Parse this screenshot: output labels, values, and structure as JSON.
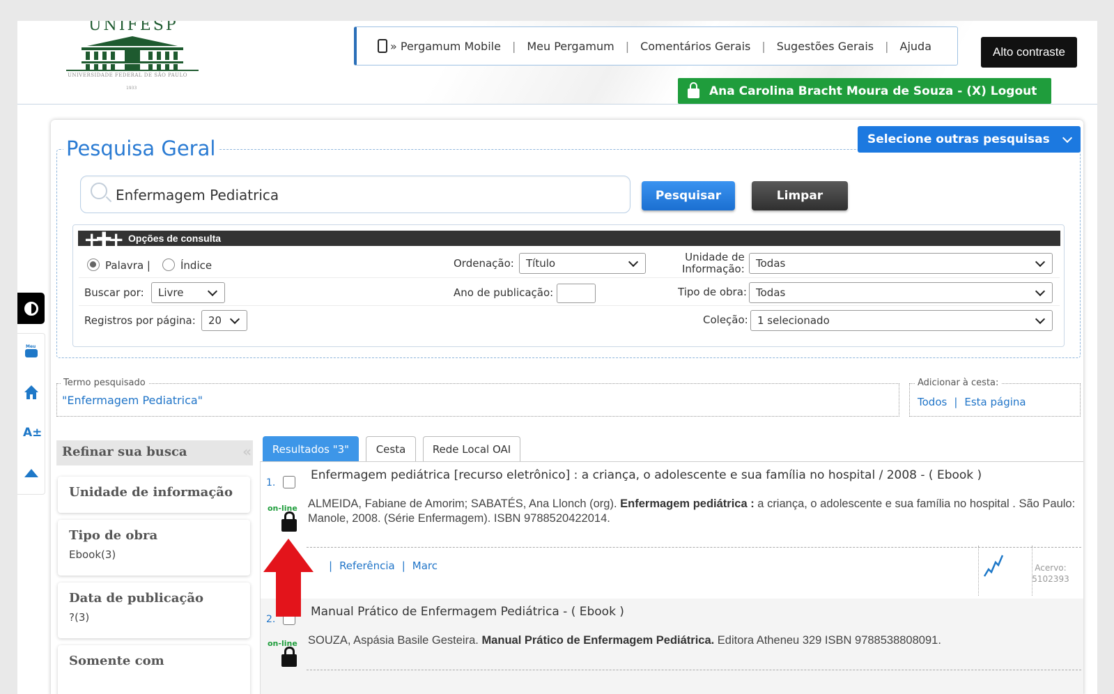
{
  "header": {
    "logo": {
      "name": "UNIFESP",
      "subtitle": "UNIVERSIDADE FEDERAL DE SÃO PAULO",
      "year": "1933"
    },
    "nav": [
      {
        "label": "» Pergamum Mobile",
        "icon": "mobile-icon"
      },
      {
        "label": "Meu Pergamum"
      },
      {
        "label": "Comentários Gerais"
      },
      {
        "label": "Sugestões Gerais"
      },
      {
        "label": "Ajuda"
      }
    ],
    "contrast_button": "Alto contraste",
    "user_bar": "Ana Carolina Bracht Moura de Souza - (X) Logout"
  },
  "accessibility_toolbar": {
    "icons": [
      "contrast-icon",
      "meu-pergamum-icon",
      "home-icon",
      "font-size-icon",
      "scroll-top-icon"
    ],
    "font_size_label": "A±"
  },
  "search_panel": {
    "title": "Pesquisa Geral",
    "other_searches": "Selecione outras pesquisas",
    "query": "Enfermagem Pediatrica",
    "search_button": "Pesquisar",
    "clear_button": "Limpar",
    "options": {
      "header": "Opções de consulta",
      "radio_palavra": "Palavra |",
      "radio_indice": "Índice",
      "radio_selected": "Palavra",
      "ordenacao_label": "Ordenação:",
      "ordenacao_value": "Título",
      "unidade_label_1": "Unidade de",
      "unidade_label_2": "Informação:",
      "unidade_value": "Todas",
      "buscar_label": "Buscar por:",
      "buscar_value": "Livre",
      "ano_label": "Ano de publicação:",
      "ano_value": "",
      "tipo_label": "Tipo de obra:",
      "tipo_value": "Todas",
      "registros_label": "Registros por página:",
      "registros_value": "20",
      "colecao_label": "Coleção:",
      "colecao_value": "1 selecionado"
    }
  },
  "termo": {
    "legend": "Termo pesquisado",
    "value": "\"Enfermagem Pediatrica\""
  },
  "cesta": {
    "legend": "Adicionar à cesta:",
    "todos": "Todos",
    "sep": "|",
    "esta_pagina": "Esta página"
  },
  "refine": {
    "title": "Refinar sua busca",
    "collapse_icon": "«",
    "groups": [
      {
        "title": "Unidade de informação",
        "value": ""
      },
      {
        "title": "Tipo de obra",
        "value": "Ebook(3)"
      },
      {
        "title": "Data de publicação",
        "value": "?(3)"
      },
      {
        "title": "Somente com",
        "value": ""
      }
    ]
  },
  "tabs": [
    {
      "label": "Resultados \"3\"",
      "active": true
    },
    {
      "label": "Cesta",
      "active": false
    },
    {
      "label": "Rede Local OAI",
      "active": false
    }
  ],
  "results": [
    {
      "num": "1.",
      "online_label": "on-line",
      "title": "Enfermagem pediátrica [recurso eletrônico] : a criança, o adolescente e sua família no hospital / 2008 -  ( Ebook )",
      "authors": "ALMEIDA, Fabiane de Amorim; SABATÉS, Ana Llonch (org). ",
      "bold_title": "Enfermagem pediátrica :",
      "desc_rest": " a criança, o adolescente e sua família no hospital . São Paulo: Manole, 2008. (Série Enfermagem). ISBN 9788520422014.",
      "links": [
        "Referência",
        "Marc"
      ],
      "acervo_label": "Acervo:",
      "acervo_value": "5102393"
    },
    {
      "num": "2.",
      "online_label": "on-line",
      "title": "Manual Prático de Enfermagem Pediátrica  -  ( Ebook )",
      "authors": "SOUZA, Aspásia Basile Gesteira. ",
      "bold_title": "Manual Prático de Enfermagem Pediátrica.",
      "desc_rest": " Editora Atheneu 329 ISBN 9788538808091."
    }
  ],
  "annotation": {
    "arrow_color": "#e3141b"
  }
}
